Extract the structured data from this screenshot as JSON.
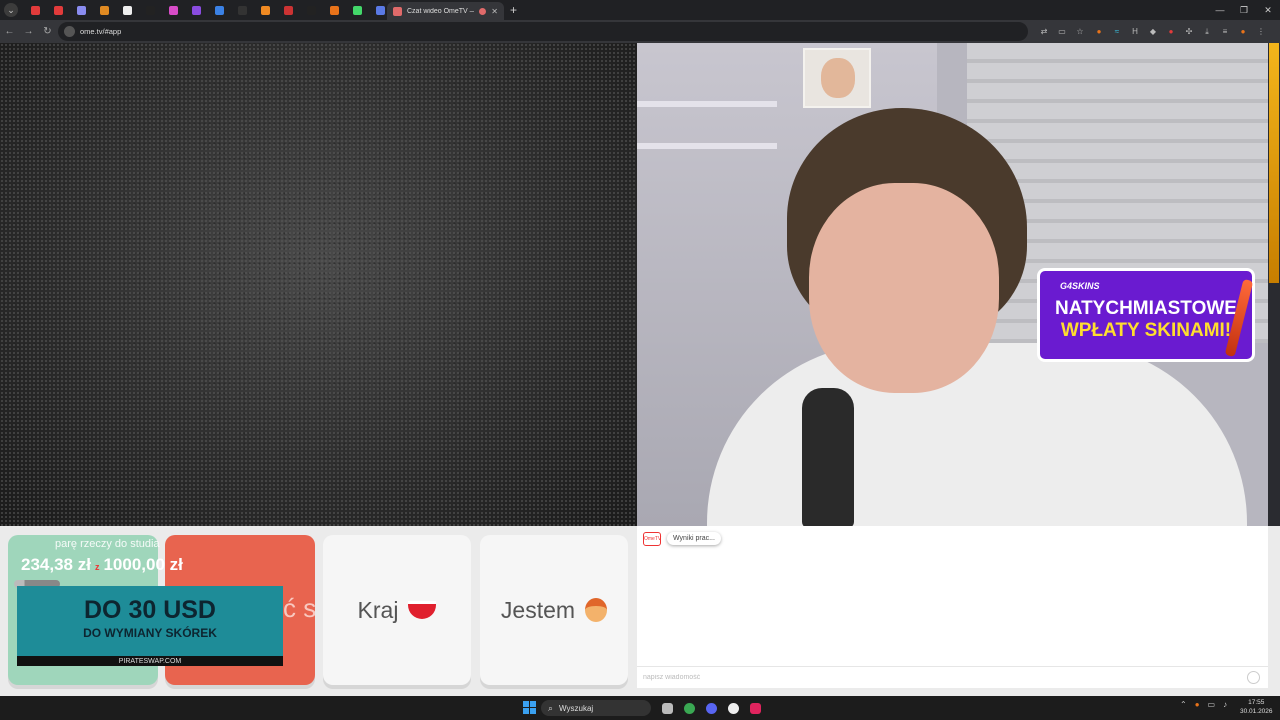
{
  "browser": {
    "pinned_tabs": [
      {
        "name": "tab-pinned-1",
        "color": "#e23b3b"
      },
      {
        "name": "tab-pinned-2",
        "color": "#e23b3b"
      },
      {
        "name": "tab-pinned-3",
        "color": "#8a8cf0"
      },
      {
        "name": "tab-pinned-4",
        "color": "#e08a22"
      },
      {
        "name": "tab-pinned-5",
        "color": "#eeeeee"
      },
      {
        "name": "tab-pinned-6",
        "color": "#222222"
      },
      {
        "name": "tab-pinned-7",
        "color": "#d84cc8"
      },
      {
        "name": "tab-pinned-8",
        "color": "#8a4ce0"
      },
      {
        "name": "tab-pinned-9",
        "color": "#3b82e6"
      },
      {
        "name": "tab-pinned-10",
        "color": "#333333"
      },
      {
        "name": "tab-pinned-11",
        "color": "#f08a22"
      },
      {
        "name": "tab-pinned-12",
        "color": "#cc3333"
      },
      {
        "name": "tab-pinned-13",
        "color": "#222222"
      },
      {
        "name": "tab-pinned-14",
        "color": "#e8731a"
      },
      {
        "name": "tab-pinned-15",
        "color": "#43d86a"
      },
      {
        "name": "tab-pinned-16",
        "color": "#5a7ae6"
      }
    ],
    "active_tab_title": "Czat wideo OmeTV — alter",
    "url": "ome.tv/#app"
  },
  "bottom": {
    "goal_label": "parę rzeczy do studia",
    "goal_current": "234,38 zł",
    "goal_sep": "z",
    "goal_target": "1000,00 zł",
    "goal_progress": 0.23,
    "promo_line1": "DO 30 USD",
    "promo_line2": "DO WYMIANY SKÓREK",
    "promo_site": "PIRATESWAP.COM",
    "partial_text": "ć się",
    "country_label": "Kraj",
    "me_label": "Jestem"
  },
  "ad": {
    "brand": "G4SKINS",
    "line1": "NATYCHMIASTOWE",
    "line2": "WPŁATY SKINAMI!"
  },
  "chat": {
    "logo": "OmeTV",
    "message": "Wyniki prac...",
    "input_placeholder": "napisz wiadomość"
  },
  "taskbar": {
    "search_label": "Wyszukaj",
    "time": "17:55",
    "date": "30.01.2026"
  }
}
